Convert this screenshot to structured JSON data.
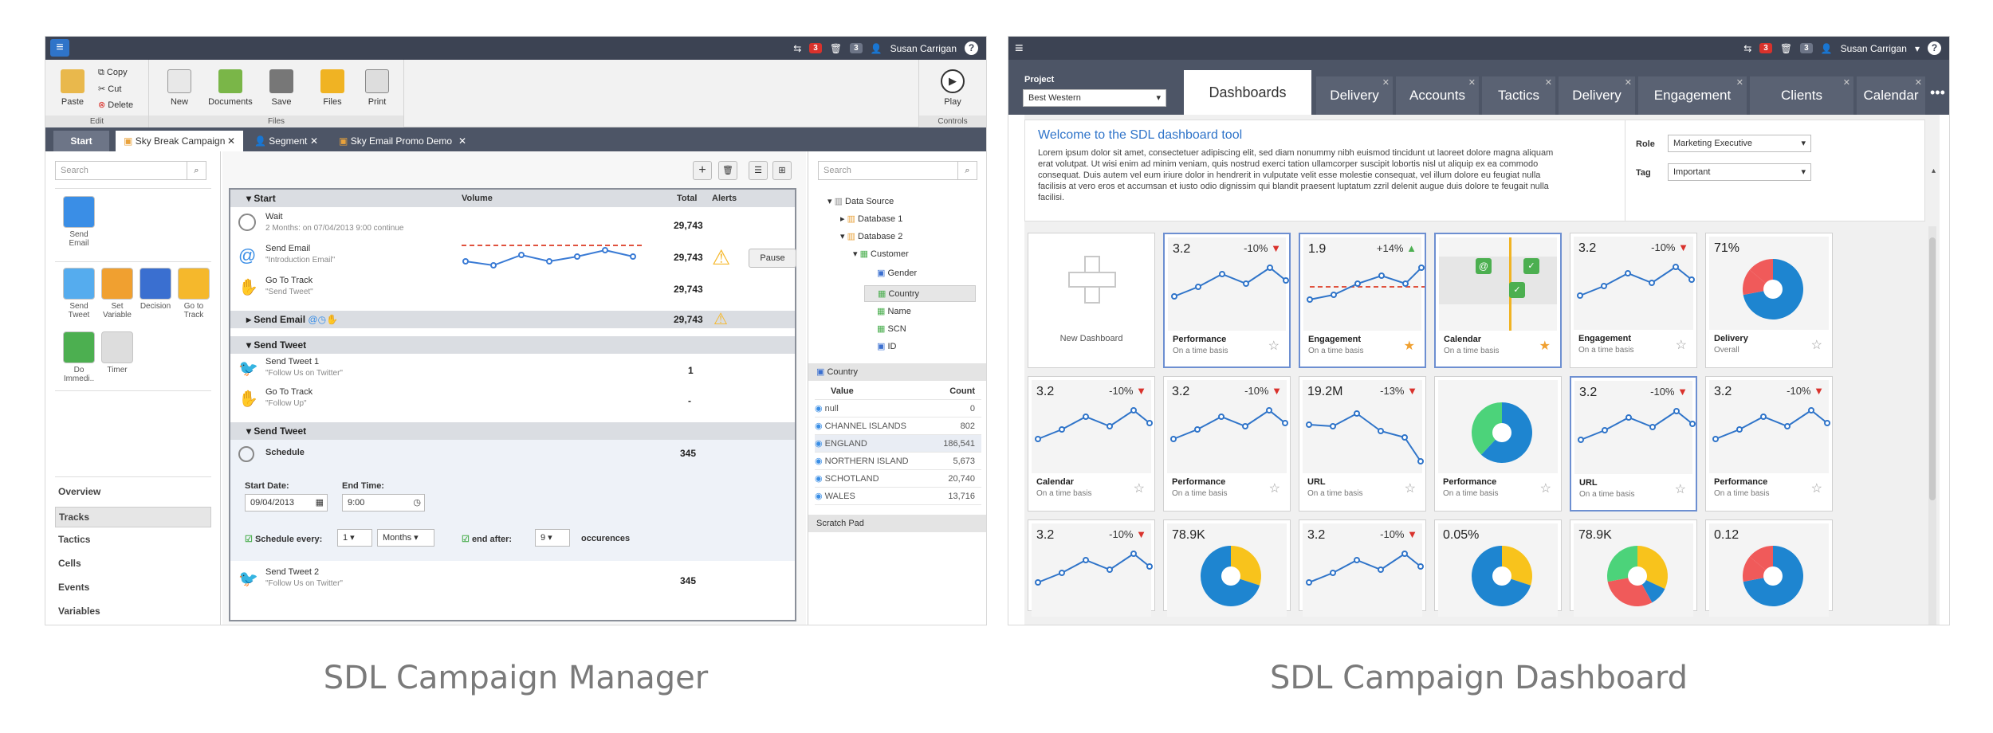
{
  "left": {
    "topbar": {
      "badge1": "3",
      "badge2": "3",
      "user": "Susan Carrigan",
      "help": "?"
    },
    "ribbon": {
      "paste": "Paste",
      "copy": "Copy",
      "cut": "Cut",
      "delete": "Delete",
      "edit_group": "Edit",
      "new": "New",
      "documents": "Documents",
      "save": "Save",
      "files": "Files",
      "print": "Print",
      "files_group": "Files",
      "play": "Play",
      "controls_group": "Controls"
    },
    "tabs": {
      "start": "Start",
      "t1": "Sky Break Campaign",
      "t2": "Segment",
      "t3": "Sky Email Promo Demo"
    },
    "search_placeholder": "Search",
    "tools": [
      "Send Email",
      "Send Tweet",
      "Set Variable",
      "Decision",
      "Go to Track",
      "Do Immedi..",
      "Timer"
    ],
    "nav": [
      "Overview",
      "Tracks",
      "Tactics",
      "Cells",
      "Events",
      "Variables"
    ],
    "flow": {
      "h_start": "Start",
      "h_volume": "Volume",
      "h_total": "Total",
      "h_alerts": "Alerts",
      "wait": "Wait",
      "wait_sub": "2 Months: on 07/04/2013 9:00 continue",
      "wait_total": "29,743",
      "send_email": "Send Email",
      "send_email_sub": "\"Introduction Email\"",
      "send_email_total": "29,743",
      "pause": "Pause",
      "goto": "Go To Track",
      "goto_sub": "\"Send Tweet\"",
      "goto_total": "29,743",
      "sec_send_email": "Send Email",
      "sec_send_email_total": "29,743",
      "sec_tweet1": "Send Tweet",
      "tweet1": "Send Tweet 1",
      "tweet1_sub": "\"Follow Us on Twitter\"",
      "tweet1_total": "1",
      "goto2": "Go To Track",
      "goto2_sub": "\"Follow Up\"",
      "goto2_total": "-",
      "sec_tweet2": "Send Tweet",
      "schedule": "Schedule",
      "schedule_total": "345",
      "start_date_label": "Start Date:",
      "start_date": "09/04/2013",
      "end_time_label": "End Time:",
      "end_time": "9:00",
      "sched_every": "Schedule every:",
      "every_val": "1",
      "every_unit": "Months",
      "end_after": "end after:",
      "end_after_val": "9",
      "occurences": "occurences",
      "tweet2": "Send Tweet 2",
      "tweet2_sub": "\"Follow Us on Twitter\"",
      "tweet2_total": "345"
    },
    "right": {
      "search_placeholder": "Search",
      "data_source": "Data Source",
      "db1": "Database 1",
      "db2": "Database 2",
      "customer": "Customer",
      "fields": [
        "Gender",
        "Country",
        "Name",
        "SCN",
        "ID"
      ],
      "country_header": "Country",
      "value_col": "Value",
      "count_col": "Count",
      "rows": [
        [
          "null",
          "0"
        ],
        [
          "CHANNEL ISLANDS",
          "802"
        ],
        [
          "ENGLAND",
          "186,541"
        ],
        [
          "NORTHERN ISLAND",
          "5,673"
        ],
        [
          "SCHOTLAND",
          "20,740"
        ],
        [
          "WALES",
          "13,716"
        ]
      ],
      "scratch": "Scratch Pad"
    },
    "caption": "SDL Campaign Manager"
  },
  "dash": {
    "topbar": {
      "badge1": "3",
      "badge2": "3",
      "user": "Susan Carrigan",
      "help": "?"
    },
    "project_label": "Project",
    "project_value": "Best Western",
    "tabs": [
      "Dashboards",
      "Delivery",
      "Accounts",
      "Tactics",
      "Delivery",
      "Engagement",
      "Clients",
      "Calendar"
    ],
    "welcome_title": "Welcome to the SDL dashboard tool",
    "welcome_text": "Lorem ipsum dolor sit amet, consectetuer adipiscing elit, sed diam nonummy nibh euismod tincidunt ut laoreet dolore magna aliquam erat volutpat. Ut wisi enim ad minim veniam, quis nostrud exerci tation ullamcorper suscipit lobortis nisl ut aliquip ex ea commodo consequat. Duis autem vel eum iriure dolor in hendrerit in vulputate velit esse molestie consequat, vel illum dolore eu feugiat nulla facilisis at vero eros et accumsan et iusto odio dignissim qui blandit praesent luptatum zzril delenit augue duis dolore te feugait nulla facilisi.",
    "role_label": "Role",
    "role_value": "Marketing Executive",
    "tag_label": "Tag",
    "tag_value": "Important",
    "new_dashboard": "New Dashboard",
    "cards": [
      {
        "kind": "line",
        "value": "3.2",
        "delta": "-10%",
        "dir": "down",
        "title": "Performance",
        "sub": "On a time basis",
        "starred": false
      },
      {
        "kind": "line2",
        "value": "1.9",
        "delta": "+14%",
        "dir": "up",
        "title": "Engagement",
        "sub": "On a time basis",
        "starred": true
      },
      {
        "kind": "calendar",
        "value": "",
        "delta": "",
        "dir": "",
        "title": "Calendar",
        "sub": "On a time basis",
        "starred": true
      },
      {
        "kind": "line",
        "value": "3.2",
        "delta": "-10%",
        "dir": "down",
        "title": "Engagement",
        "sub": "On a time basis",
        "starred": false
      },
      {
        "kind": "pie",
        "value": "71%",
        "delta": "",
        "dir": "",
        "title": "Delivery",
        "sub": "Overall",
        "starred": false
      },
      {
        "kind": "line",
        "value": "3.2",
        "delta": "-10%",
        "dir": "down",
        "title": "Calendar",
        "sub": "On a time basis",
        "starred": false
      },
      {
        "kind": "line",
        "value": "3.2",
        "delta": "-10%",
        "dir": "down",
        "title": "Performance",
        "sub": "On a time basis",
        "starred": false
      },
      {
        "kind": "line3",
        "value": "19.2M",
        "delta": "-13%",
        "dir": "down",
        "title": "URL",
        "sub": "On a time basis",
        "starred": false
      },
      {
        "kind": "pie2",
        "value": "",
        "delta": "",
        "dir": "",
        "title": "Performance",
        "sub": "On a time basis",
        "starred": false
      },
      {
        "kind": "line",
        "value": "3.2",
        "delta": "-10%",
        "dir": "down",
        "title": "URL",
        "sub": "On a time basis",
        "starred": false
      },
      {
        "kind": "line",
        "value": "3.2",
        "delta": "-10%",
        "dir": "down",
        "title": "Performance",
        "sub": "On a time basis",
        "starred": false
      },
      {
        "kind": "line",
        "value": "3.2",
        "delta": "-10%",
        "dir": "down",
        "title": "",
        "sub": "",
        "starred": false
      },
      {
        "kind": "pie3",
        "value": "78.9K",
        "delta": "",
        "dir": "",
        "title": "",
        "sub": "",
        "starred": false
      },
      {
        "kind": "line",
        "value": "3.2",
        "delta": "-10%",
        "dir": "down",
        "title": "",
        "sub": "",
        "starred": false
      },
      {
        "kind": "pie3",
        "value": "0.05%",
        "delta": "",
        "dir": "",
        "title": "",
        "sub": "",
        "starred": false
      },
      {
        "kind": "pie4",
        "value": "78.9K",
        "delta": "",
        "dir": "",
        "title": "",
        "sub": "",
        "starred": false
      },
      {
        "kind": "pie",
        "value": "0.12",
        "delta": "",
        "dir": "",
        "title": "",
        "sub": "",
        "starred": false
      }
    ],
    "caption": "SDL Campaign Dashboard"
  }
}
